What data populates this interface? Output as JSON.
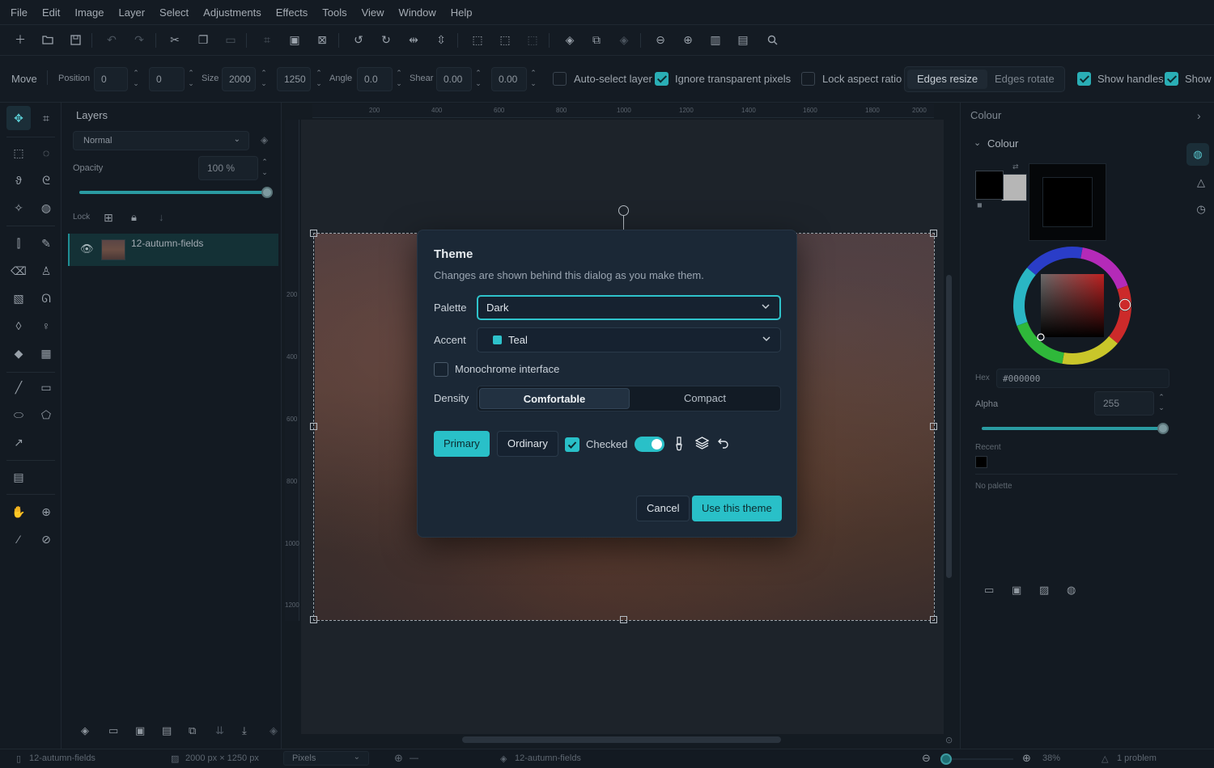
{
  "menubar": {
    "items": [
      "File",
      "Edit",
      "Image",
      "Layer",
      "Select",
      "Adjustments",
      "Effects",
      "Tools",
      "View",
      "Window",
      "Help"
    ]
  },
  "options": {
    "tool_name": "Move",
    "position_label": "Position",
    "position_x": "0",
    "position_y": "0",
    "size_label": "Size",
    "size_w": "2000",
    "size_h": "1250",
    "angle_label": "Angle",
    "angle_value": "0.0",
    "shear_label": "Shear",
    "shear_x": "0.00",
    "shear_y": "0.00",
    "auto_select_label": "Auto-select layer",
    "ignore_transparent_label": "Ignore transparent pixels",
    "lock_aspect_label": "Lock aspect ratio",
    "edges_resize": "Edges resize",
    "edges_rotate": "Edges rotate",
    "show_handles_label": "Show handles",
    "show_extra_label": "Show"
  },
  "layers": {
    "title": "Layers",
    "blend_mode": "Normal",
    "opacity_label": "Opacity",
    "opacity_value": "100 %",
    "opacity_fraction": 1.0,
    "lock_label": "Lock",
    "layer_name": "12-autumn-fields"
  },
  "ruler": {
    "top_ticks": [
      "200",
      "400",
      "600",
      "800",
      "1000",
      "1200",
      "1400",
      "1600",
      "1800",
      "2000"
    ],
    "left_ticks": [
      "200",
      "400",
      "600",
      "800",
      "1000",
      "1200"
    ]
  },
  "colour_panel": {
    "header": "Colour",
    "section": "Colour",
    "hex_label": "Hex",
    "hex_value": "#000000",
    "alpha_label": "Alpha",
    "alpha_value": "255",
    "recent_label": "Recent",
    "palette_label": "No palette"
  },
  "status": {
    "document": "12-autumn-fields",
    "dimensions": "2000 px × 1250 px",
    "units": "Pixels",
    "cursor": "—",
    "layer": "12-autumn-fields",
    "zoom": "38%",
    "problems": "1 problem"
  },
  "dialog": {
    "title": "Theme",
    "subtitle": "Changes are shown behind this dialog as you make them.",
    "palette_label": "Palette",
    "palette_value": "Dark",
    "accent_label": "Accent",
    "accent_value": "Teal",
    "accent_color": "#2ec2cb",
    "monochrome_label": "Monochrome interface",
    "density_label": "Density",
    "density_options": [
      "Comfortable",
      "Compact"
    ],
    "preview_primary": "Primary",
    "preview_ordinary": "Ordinary",
    "preview_checked": "Checked",
    "cancel_label": "Cancel",
    "confirm_label": "Use this theme"
  },
  "colors": {
    "accent": "#29c0c8",
    "background": "#111820"
  }
}
